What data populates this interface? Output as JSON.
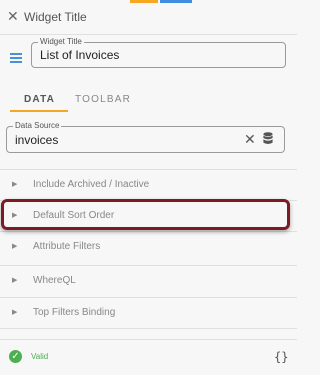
{
  "header": {
    "close_icon": "close-icon",
    "title": "Widget Title"
  },
  "widget_title_field": {
    "legend": "Widget Title",
    "value": "List of Invoices"
  },
  "tabs": [
    {
      "label": "DATA",
      "active": true
    },
    {
      "label": "TOOLBAR",
      "active": false
    }
  ],
  "data_source": {
    "legend": "Data Source",
    "value": "invoices",
    "icons": [
      "clear-icon",
      "database-icon"
    ]
  },
  "sections": [
    {
      "label": "Include Archived / Inactive"
    },
    {
      "label": "Default Sort Order",
      "highlighted": true
    },
    {
      "label": "Attribute Filters"
    },
    {
      "label": "WhereQL"
    },
    {
      "label": "Top Filters Binding"
    }
  ],
  "footer": {
    "status": "Valid",
    "json_icon": "{}"
  },
  "colors": {
    "accent_orange": "#f5a623",
    "accent_blue": "#3f8de0",
    "valid_green": "#4caf50",
    "highlight_border": "#7c1b24"
  }
}
